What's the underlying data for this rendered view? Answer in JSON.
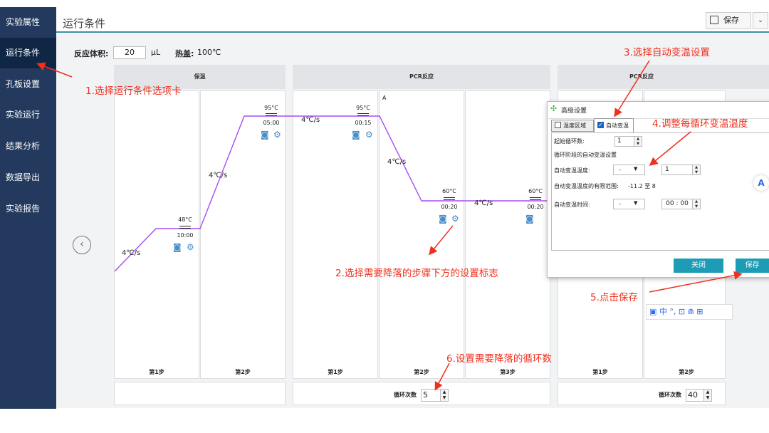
{
  "sidebar": {
    "items": [
      {
        "label": "实验属性"
      },
      {
        "label": "运行条件"
      },
      {
        "label": "孔板设置"
      },
      {
        "label": "实验运行"
      },
      {
        "label": "结果分析"
      },
      {
        "label": "数据导出"
      },
      {
        "label": "实验报告"
      }
    ]
  },
  "header": {
    "title": "运行条件",
    "save_label": "保存",
    "dropdown": "⌄"
  },
  "reaction": {
    "volume_label": "反应体积:",
    "volume_value": "20",
    "volume_unit": "μL",
    "lid_label": "热盖:",
    "lid_value": "100℃"
  },
  "stages": [
    {
      "title": "保温",
      "steps": [
        {
          "label": "第1步",
          "temp": "48°C",
          "time": "10:00",
          "rate": "4℃/s"
        },
        {
          "label": "第2步",
          "temp": "95°C",
          "time": "05:00",
          "rate": "4℃/s"
        }
      ]
    },
    {
      "title": "PCR反应",
      "marker": "A",
      "steps": [
        {
          "label": "第1步",
          "temp": "95°C",
          "time": "00:15",
          "rate": "4℃/s"
        },
        {
          "label": "第2步",
          "temp": "60°C",
          "time": "00:20",
          "rate": "4℃/s"
        },
        {
          "label": "第3步",
          "temp": "60°C",
          "time": "00:20",
          "rate": "4℃/s"
        }
      ],
      "cycle_label": "循环次数",
      "cycle_value": "5"
    },
    {
      "title": "PCR反应",
      "steps": [
        {
          "label": "第1步"
        },
        {
          "label": "第2步"
        }
      ],
      "cycle_label": "循环次数",
      "cycle_value": "40"
    }
  ],
  "dialog": {
    "title": "高级设置",
    "tab1": "温度区域",
    "tab2": "自动变温",
    "start_cycle_label": "起始循环数:",
    "start_cycle_value": "1",
    "section_label": "循环阶段的自动变温设置",
    "auto_temp_label": "自动变温温度:",
    "auto_temp_sign": "-",
    "auto_temp_value": "1",
    "range_label": "自动变温温度的有限范围:",
    "range_value": "-11.2 至 8",
    "auto_time_label": "自动变温时间:",
    "auto_time_sign": "-",
    "auto_time_value": "00 : 00",
    "close_label": "关闭",
    "save_label": "保存"
  },
  "annotations": {
    "a1": "1.选择运行条件选项卡",
    "a2": "2.选择需要降落的步骤下方的设置标志",
    "a3": "3.选择自动变温设置",
    "a4": "4.调整每循环变温温度",
    "a5": "5.点击保存",
    "a6": "6.设置需要降落的循环数"
  },
  "ime": {
    "text": "中 °, ⊡ ⋒ ⊞"
  },
  "colors": {
    "accent": "#1e9bb5",
    "sidebar": "#233a5e",
    "curve": "#a64ef0",
    "annotation": "#f0301e"
  }
}
